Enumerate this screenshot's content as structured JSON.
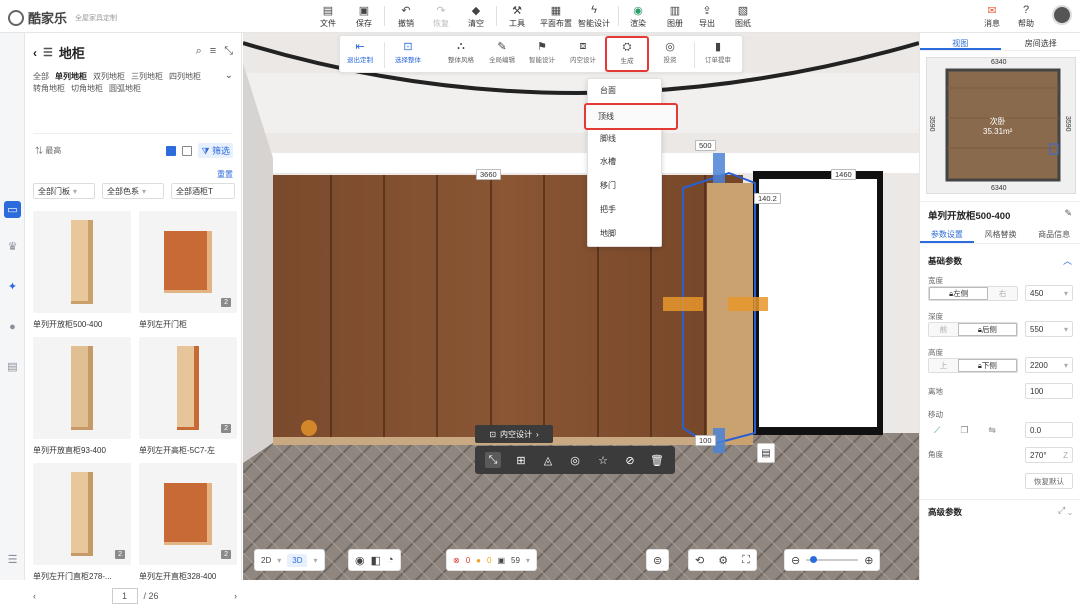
{
  "app": {
    "brand": "酷家乐",
    "subtitle": "全屋家具定制"
  },
  "toolbar": {
    "file": "文件",
    "save": "保存",
    "undo": "撤销",
    "redo": "恢复",
    "clear": "清空",
    "tools": "工具",
    "floor_layout": "平面布置",
    "smart_design": "智能设计",
    "render": "渲染",
    "album": "图册",
    "export": "导出",
    "drawings": "图纸",
    "messages": "消息",
    "help": "帮助"
  },
  "left_panel": {
    "title": "地柜",
    "categories_row1": [
      "全部",
      "单列地柜",
      "双列地柜",
      "三列地柜",
      "四列地柜"
    ],
    "categories_row2": [
      "转角地柜",
      "切角地柜",
      "圆弧地柜"
    ],
    "active_category": "单列地柜",
    "sort_label": "最高",
    "filter_label": "筛选",
    "reset_label": "重置",
    "dropdowns": [
      "全部门板",
      "全部色系",
      "全部酒柜T"
    ],
    "products": [
      {
        "name": "单列开放柜500-400",
        "badge": ""
      },
      {
        "name": "单列左开门柜",
        "badge": "2"
      },
      {
        "name": "单列开放直柜93-400",
        "badge": ""
      },
      {
        "name": "单列左开高柜-5C7-左",
        "badge": "2"
      },
      {
        "name": "单列左开门直柜278-...",
        "badge": "2"
      },
      {
        "name": "单列左开直柜328-400",
        "badge": "2"
      }
    ],
    "page_current": "1",
    "page_total": "/ 26"
  },
  "sub_toolbar": {
    "exit_custom": "退出定制",
    "select_whole": "选择整体",
    "whole_style": "整体风格",
    "global_edit": "全局编辑",
    "smart_design": "智能设计",
    "inner_design": "内空设计",
    "generate": "生成",
    "scheme": "投资",
    "order_submit": "订单提审"
  },
  "generate_menu": [
    "台面",
    "顶线",
    "脚线",
    "水槽",
    "移门",
    "把手",
    "地脚"
  ],
  "generate_menu_selected": "顶线",
  "viewport": {
    "dims": {
      "top": "500",
      "width_total": "3660",
      "right_gap": "1460",
      "side": "140.2",
      "bottom": "100"
    },
    "inner_design_label": "内空设计"
  },
  "right_panel": {
    "tabs": [
      "视图",
      "房间选择"
    ],
    "minimap": {
      "top": "6340",
      "bottom": "6340",
      "left": "3590",
      "right": "3590",
      "room_name": "次卧",
      "area": "35.31m²"
    },
    "title": "单列开放柜500-400",
    "prop_tabs": [
      "参数设置",
      "风格替换",
      "商品信息"
    ],
    "basic_params": "基础参数",
    "width_label": "宽度",
    "width_left": "左侧",
    "width_right": "右",
    "width_value": "450",
    "depth_label": "深度",
    "depth_front": "前",
    "depth_back": "后侧",
    "depth_value": "550",
    "height_label": "高度",
    "height_up": "上",
    "height_down": "下侧",
    "height_value": "2200",
    "offground_label": "离地",
    "offground_value": "100",
    "move_label": "移动",
    "move_value": "0.0",
    "angle_label": "角度",
    "angle_value": "270°",
    "angle_axis": "Z",
    "restore_default": "恢复默认",
    "advanced_params": "高级参数"
  },
  "bottom_bar": {
    "mode_2d": "2D",
    "mode_3d": "3D",
    "errors": "0",
    "warnings": "0",
    "items": "59"
  }
}
